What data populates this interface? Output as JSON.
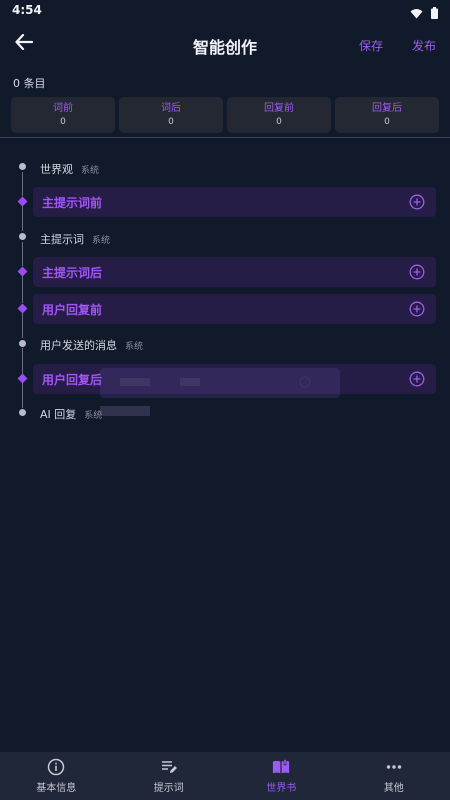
{
  "status_bar": {
    "time": "4:54",
    "icons": [
      "wifi-icon",
      "battery-icon"
    ]
  },
  "header": {
    "title": "智能创作",
    "save_label": "保存",
    "publish_label": "发布"
  },
  "entry_count": "0 条目",
  "tabs": [
    {
      "label": "词前",
      "count": "0"
    },
    {
      "label": "词后",
      "count": "0"
    },
    {
      "label": "回复前",
      "count": "0"
    },
    {
      "label": "回复后",
      "count": "0"
    }
  ],
  "timeline": [
    {
      "kind": "plain",
      "label": "世界观",
      "tag": "系统"
    },
    {
      "kind": "card",
      "label": "主提示词前"
    },
    {
      "kind": "plain",
      "label": "主提示词",
      "tag": "系统"
    },
    {
      "kind": "card",
      "label": "主提示词后"
    },
    {
      "kind": "card",
      "label": "用户回复前"
    },
    {
      "kind": "plain",
      "label": "用户发送的消息",
      "tag": "系统"
    },
    {
      "kind": "card",
      "label": "用户回复后"
    },
    {
      "kind": "plain",
      "label": "AI 回复",
      "tag": "系统"
    }
  ],
  "bottom_nav": [
    {
      "label": "基本信息",
      "icon": "info-icon"
    },
    {
      "label": "提示词",
      "icon": "edit-list-icon"
    },
    {
      "label": "世界书",
      "icon": "book-icon",
      "active": true
    },
    {
      "label": "其他",
      "icon": "more-icon"
    }
  ],
  "colors": {
    "background": "#111a2b",
    "accent": "#9d5cf0",
    "card": "#251d45",
    "tab": "#242833",
    "nav": "#1f2738"
  }
}
